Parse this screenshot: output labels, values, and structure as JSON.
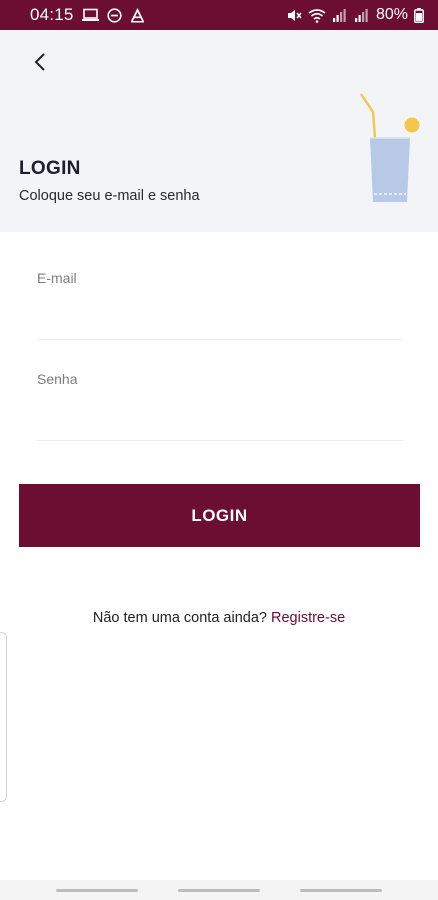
{
  "status_bar": {
    "time": "04:15",
    "battery": "80%",
    "icons_left": [
      "laptop-icon",
      "do-not-disturb-icon",
      "font-icon"
    ],
    "icons_right": [
      "mute-icon",
      "wifi-icon",
      "signal-icon",
      "signal-icon-2",
      "battery-icon"
    ],
    "background": "#6b0e31"
  },
  "header": {
    "back_icon": "chevron-left-icon",
    "title": "LOGIN",
    "subtitle": "Coloque seu e-mail e senha",
    "illustration": "drink-glass-illustration",
    "background": "#f3f4f8"
  },
  "form": {
    "email_label": "E-mail",
    "email_value": "",
    "password_label": "Senha",
    "password_value": "",
    "submit_label": "LOGIN"
  },
  "register": {
    "prompt": "Não tem uma conta ainda?",
    "link": "Registre-se"
  },
  "colors": {
    "accent": "#6b0e31",
    "glass": "#b7c9e6",
    "straw": "#f2c84b"
  }
}
